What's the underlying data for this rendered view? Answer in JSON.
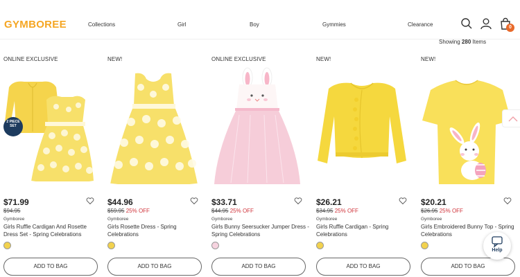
{
  "brand": {
    "logo": "GYMBOREE",
    "accent": "#f5a623"
  },
  "nav": {
    "collections": "Collections",
    "girl": "Girl",
    "boy": "Boy",
    "gymmies": "Gymmies",
    "clearance": "Clearance"
  },
  "header_icons": [
    "search-icon",
    "account-icon",
    "bag-icon"
  ],
  "bag": {
    "count": "0"
  },
  "results": {
    "prefix": "Showing",
    "count": "280",
    "suffix": "Items"
  },
  "products": [
    {
      "flag": "ONLINE EXCLUSIVE",
      "price": "$71.99",
      "old_price": "$94.95",
      "off": "",
      "brand": "Gymboree",
      "name": "Girls Ruffle Cardigan And Rosette Dress Set - Spring Celebrations",
      "swatch": "#f2d24e",
      "badge": "2 PIECE SET",
      "button": "ADD TO BAG"
    },
    {
      "flag": "NEW!",
      "price": "$44.96",
      "old_price": "$59.95",
      "off": "25% OFF",
      "brand": "Gymboree",
      "name": "Girls Rosette Dress - Spring Celebrations",
      "swatch": "#f2d24e",
      "button": "ADD TO BAG"
    },
    {
      "flag": "ONLINE EXCLUSIVE",
      "price": "$33.71",
      "old_price": "$44.95",
      "off": "25% OFF",
      "brand": "Gymboree",
      "name": "Girls Bunny Seersucker Jumper Dress - Spring Celebrations",
      "swatch": "#f6d3df",
      "button": "ADD TO BAG"
    },
    {
      "flag": "NEW!",
      "price": "$26.21",
      "old_price": "$34.95",
      "off": "25% OFF",
      "brand": "Gymboree",
      "name": "Girls Ruffle Cardigan - Spring Celebrations",
      "swatch": "#f2d24e",
      "button": "ADD TO BAG"
    },
    {
      "flag": "NEW!",
      "price": "$20.21",
      "old_price": "$26.95",
      "off": "25% OFF",
      "brand": "Gymboree",
      "name": "Girls Embroidered Bunny Top - Spring Celebrations",
      "swatch": "#f2d24e",
      "button": "ADD TO BAG"
    }
  ],
  "help": {
    "label": "Help"
  },
  "colors": {
    "sale_red": "#d0333a",
    "badge_navy": "#1d3b5e",
    "bag_orange": "#e8692a"
  }
}
